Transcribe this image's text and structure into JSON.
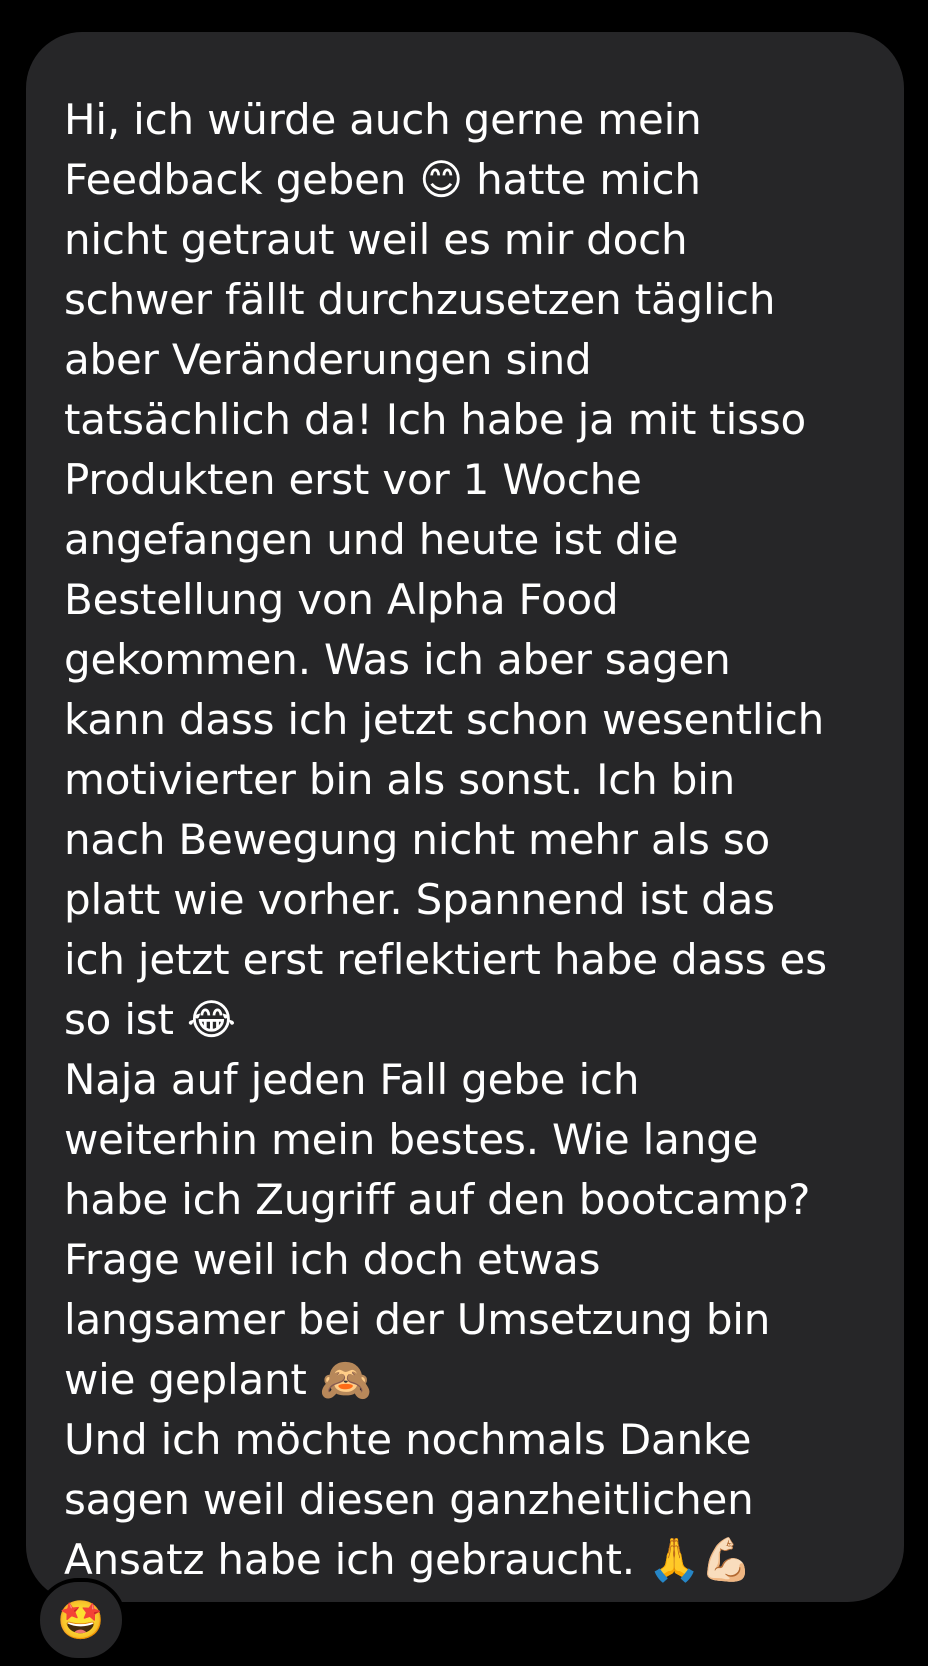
{
  "message": {
    "lines": [
      "Hi, ich würde auch gerne mein",
      "Feedback geben 😊 hatte mich",
      "nicht getraut weil es mir doch",
      "schwer fällt durchzusetzen täglich",
      "aber Veränderungen sind",
      "tatsächlich da! Ich habe ja mit tisso",
      "Produkten erst vor 1 Woche",
      "angefangen und heute ist die",
      "Bestellung von Alpha Food",
      "gekommen. Was ich aber sagen",
      "kann dass ich jetzt schon wesentlich",
      "motivierter bin als sonst. Ich bin",
      "nach Bewegung nicht mehr als so",
      "platt wie vorher. Spannend ist das",
      "ich jetzt erst reflektiert habe dass es",
      "so ist 😂",
      "Naja auf jeden Fall gebe ich",
      "weiterhin mein bestes. Wie lange",
      "habe ich Zugriff auf den bootcamp?",
      "Frage weil ich doch etwas",
      "langsamer bei der Umsetzung bin",
      "wie geplant 🙈",
      "Und ich möchte nochmals Danke",
      "sagen weil diesen ganzheitlichen",
      "Ansatz habe ich gebraucht. 🙏💪🏻"
    ]
  },
  "reaction": {
    "emoji": "🤩"
  },
  "colors": {
    "background": "#000000",
    "bubble": "#262628",
    "text": "#ffffff"
  }
}
